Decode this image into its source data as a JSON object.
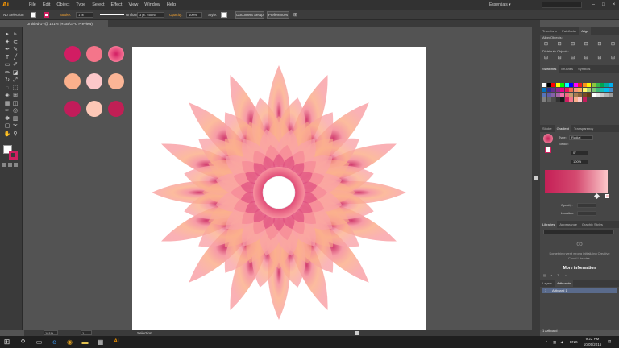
{
  "app": {
    "logo": "Ai",
    "workspace": "Essentials ▾"
  },
  "menu": [
    "File",
    "Edit",
    "Object",
    "Type",
    "Select",
    "Effect",
    "View",
    "Window",
    "Help"
  ],
  "control": {
    "selection": "No Selection",
    "stroke_label": "Stroke:",
    "stroke_value": "1 pt",
    "profile": "Uniform",
    "brush": "3 pt. Round",
    "opacity_label": "Opacity:",
    "opacity_value": "100%",
    "style_label": "Style:",
    "doc_setup": "Document Setup",
    "preferences": "Preferences"
  },
  "document": {
    "tab": "Untitled-1* @ 181% (RGB/GPU Preview)"
  },
  "swatch_colors": [
    "#d21d63",
    "#f4758a",
    "#f26a8f",
    "#fbb08c",
    "#fcc7c9",
    "#fbb596",
    "#c21c5a",
    "#fcc7b6",
    "#c11f55"
  ],
  "panels": {
    "top_tabs": [
      "Transform",
      "Pathfinder",
      "Align"
    ],
    "align_objects": "Align Objects:",
    "distribute_objects": "Distribute Objects:",
    "swatch_tabs": [
      "Swatches",
      "Brushes",
      "Symbols"
    ],
    "gradient_tabs": [
      "Stroke",
      "Gradient",
      "Transparency"
    ],
    "gradient": {
      "type_label": "Type:",
      "type_value": "Radial",
      "stroke_label": "Stroke:",
      "angle": "0°",
      "aspect": "100%",
      "opacity_label": "Opacity:",
      "location_label": "Location:",
      "start_color": "#c51f56",
      "end_color": "#fcc7c9"
    },
    "library_tabs": [
      "Libraries",
      "Appearance",
      "Graphic Styles"
    ],
    "library_error": "Something went wrong initializing Creative Cloud Libraries.",
    "more_info": "More information",
    "layer_tabs": [
      "Layers",
      "Artboards"
    ],
    "artboard_index": "1",
    "artboard_name": "Artboard 1",
    "artboard_count": "1 Artboard"
  },
  "status": {
    "zoom": "181%",
    "page": "1",
    "tool": "Selection"
  },
  "taskbar": {
    "lang": "ENG",
    "time": "9:22 PM",
    "date": "10/05/2016"
  },
  "flower": {
    "outer_color": "#f9a3a8",
    "mid_color": "#fbb08c",
    "center_color": "#c91a55"
  }
}
